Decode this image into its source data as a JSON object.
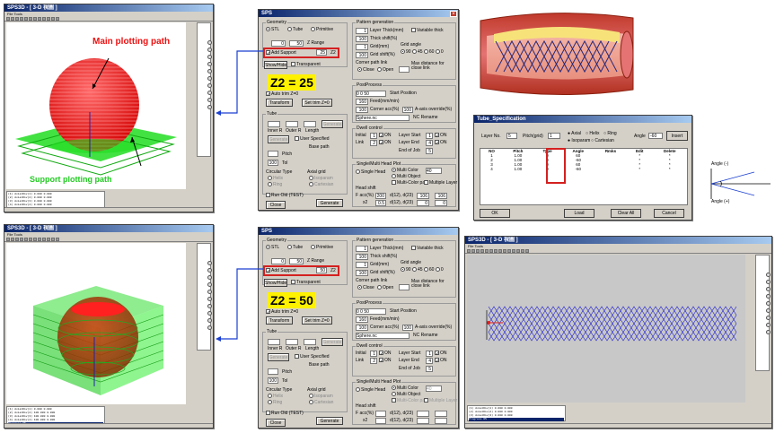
{
  "app_window": {
    "title": "SPS3D - [ 3-D 視圖 ]",
    "menu": "File  Tools",
    "annotations": {
      "main_path": "Main plotting path",
      "support_path": "Support plotting path"
    },
    "log_lines_top": [
      "(1) AxialDiv(1)  0.000  0.000",
      "(2) AxialDiv(2)  0.000  0.000",
      "(3) AxialDiv(3)  0.000  0.000",
      "(4) AxialDiv(4)  0.000  0.000",
      "Progress 0%"
    ],
    "log_lines_bottom": [
      "(1) AxialDiv(1)  0.000  0.000",
      "(2) AxialDiv(2)  100.000 0.000",
      "(3) AxialDiv(3)  100.000 0.000",
      "(4) AxialDiv(4)  100.000 0.000",
      "Progress 0%"
    ]
  },
  "sps_dialog": {
    "title": "SPS",
    "geometry": {
      "label": "Geometry",
      "options": [
        "STL",
        "Tube",
        "Primitive"
      ],
      "range_from": "0",
      "range_to": "50",
      "range_label": "Z Range",
      "add_support": "Add Support",
      "show_hide": "Show/Hide",
      "transparent": "Transparent",
      "auto_trim": "Auto trim Z=0",
      "transform": "Transform",
      "set_trim": "Set trim Z=0"
    },
    "pattern_generation": {
      "label": "Pattern generation",
      "layer_thick": "Layer Thick(mm)",
      "variable_thick": "Variable thick",
      "layer_thick_value": "1",
      "thick_shift": "Thick shift(%)",
      "thick_shift_value": "100",
      "grid_mm": "Grid(mm)",
      "grid_mm_value": "1",
      "grid_shift": "Grid shift(%)",
      "grid_shift_value": "100",
      "grid_angle": "Grid angle",
      "grid_angles": [
        "90",
        "45",
        "60",
        "0"
      ],
      "corner_link": "Corner path link",
      "corner_close": "Close",
      "corner_open": "Open",
      "max_distance": "Max distance for close link"
    },
    "post_process": {
      "label": "PostProcess",
      "start_value": "0 0 50",
      "start_position": "Start Position",
      "feed_value": "160",
      "feed_label": "Feed(mm/min)",
      "corner_acc_value": "100",
      "corner_acc_label": "Corner acc(%)",
      "a_axis_value": "100",
      "a_axis_label": "A-axis override(%)",
      "nc_file": "Sphere.nc",
      "nc_rename": "NC Rename"
    },
    "dwell_control": {
      "label": "Dwell control",
      "initial": "Initial",
      "initial_value": "1",
      "link": "Link",
      "link_value": "2",
      "on": "ON",
      "layer_start": "Layer Start",
      "layer_start_value": "1",
      "layer_end": "Layer End",
      "layer_end_value": "4",
      "end_of_job": "End of Job",
      "end_of_job_value": "5"
    },
    "tube": {
      "label": "Tube",
      "inner_r": "Inner R",
      "outer_r": "Outer R",
      "length": "Length",
      "user_specified": "User Specified",
      "generate": "Generate",
      "base_path": "Base path",
      "pitch": "Pitch",
      "tol": "Tol",
      "tol_value": "100",
      "circular_type": "Circular Type",
      "circ_options": [
        "Helix",
        "Ring"
      ],
      "axial_grid": "Axial grid",
      "axial_options": [
        "Isoparam",
        "Cartesian"
      ]
    },
    "head_plot": {
      "label": "Single/Multi Head Plot",
      "single_head": "Single Head",
      "multi_color": "Multi Color",
      "multi_color_value": "40",
      "multi_object": "Multi Object",
      "multi_color_path": "Multi-Color path",
      "multiple_layer": "Multiple Layer",
      "head_shift": "Head shift",
      "f_acc": "F acc(%)",
      "f_acc_value": "200",
      "x2": "x2",
      "x2_value": "0.5",
      "d12": "d(12), d(23)",
      "d12_a": "106",
      "d12_b": "106",
      "d23_a": "0",
      "d23_b": "0"
    },
    "run_old": "Run Old (TEST)",
    "close": "Close",
    "generate": "Generate"
  },
  "panel_top": {
    "z_value": "25",
    "label": "Z2 = 25"
  },
  "panel_bottom": {
    "z_value": "50",
    "label": "Z2 = 50"
  },
  "tube_spec": {
    "title": "Tube_Specification",
    "layer_no": "Layer No.",
    "layer_no_value": "5",
    "pitch_grid": "Pitch(grid)",
    "pitch_grid_value": "1",
    "radio1": [
      "Axial",
      "Helix",
      "Ring"
    ],
    "radio2": [
      "Isoparam",
      "Cartesian"
    ],
    "angle_label": "Angle",
    "angle_value": "-60",
    "insert": "Insert",
    "headers": [
      "NO",
      "Pitch",
      "Type",
      "Angle",
      "Rmks",
      "Edit",
      "Delete"
    ],
    "rows": [
      [
        "1",
        "1.00",
        "0",
        "60",
        "",
        "*",
        "*"
      ],
      [
        "2",
        "1.00",
        "0",
        "-60",
        "",
        "*",
        "*"
      ],
      [
        "3",
        "1.00",
        "0",
        "60",
        "",
        "*",
        "*"
      ],
      [
        "4",
        "1.00",
        "0",
        "-60",
        "",
        "*",
        "*"
      ]
    ],
    "ok": "OK",
    "load": "Load",
    "clear_all": "Clear All",
    "cancel": "Cancel"
  },
  "angle_diagram": {
    "angle_minus": "Angle (-)",
    "angle_plus": "Angle (+)"
  },
  "colors": {
    "red": "#ff1a1a",
    "green": "#22dd22",
    "arrow_blue": "#1a3fd1",
    "yellow": "#fff200",
    "stent_blue": "#1a1ad0"
  }
}
